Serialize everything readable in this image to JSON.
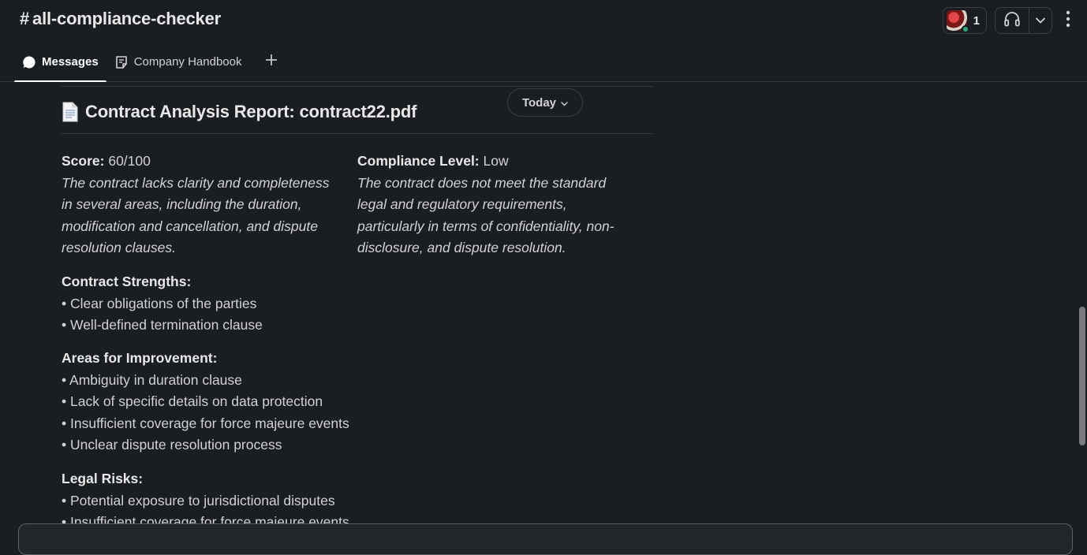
{
  "header": {
    "channel_hash": "#",
    "channel_name": "all-compliance-checker",
    "members_count": "1",
    "icons": {
      "headphones": "headphones-icon",
      "chevron": "chevron-down-icon",
      "more": "more-vertical-icon"
    }
  },
  "tabs": [
    {
      "label": "Messages",
      "icon": "message-bubble-icon",
      "active": true
    },
    {
      "label": "Company Handbook",
      "icon": "canvas-doc-icon",
      "active": false
    }
  ],
  "tab_add": "+",
  "date_divider": "Today",
  "report": {
    "title": "Contract Analysis Report: contract22.pdf",
    "score_label": "Score:",
    "score_value": "60/100",
    "score_desc": "The contract lacks clarity and completeness in several areas, including the duration, modification and cancellation, and dispute resolution clauses.",
    "compliance_label": "Compliance Level:",
    "compliance_value": "Low",
    "compliance_desc": "The contract does not meet the standard legal and regulatory requirements, particularly in terms of confidentiality, non-disclosure, and dispute resolution.",
    "strengths_title": "Contract Strengths:",
    "strengths": [
      "Clear obligations of the parties",
      "Well-defined termination clause"
    ],
    "improvements_title": "Areas for Improvement:",
    "improvements": [
      "Ambiguity in duration clause",
      "Lack of specific details on data protection",
      "Insufficient coverage for force majeure events",
      "Unclear dispute resolution process"
    ],
    "risks_title": "Legal Risks:",
    "risks": [
      "Potential exposure to jurisdictional disputes",
      "Insufficient coverage for force majeure events"
    ]
  },
  "colors": {
    "background": "#1a1d21",
    "text": "#d1d2d3",
    "presence": "#2bac76"
  }
}
